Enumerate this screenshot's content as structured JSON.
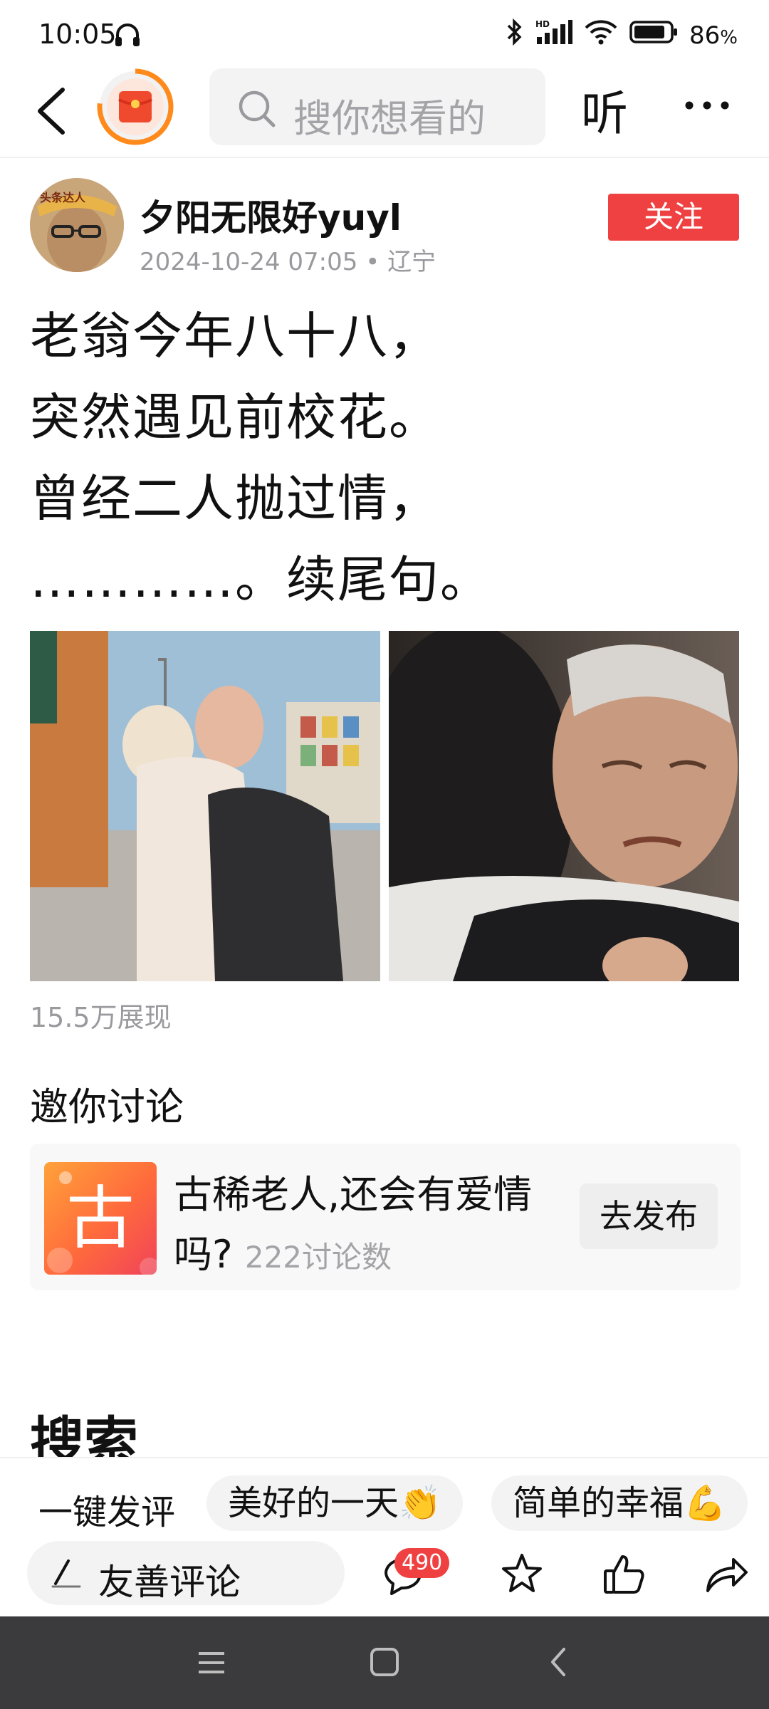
{
  "status_bar": {
    "time": "10:05",
    "battery": "86"
  },
  "header": {
    "search_placeholder": "搜你想看的",
    "listen_label": "听"
  },
  "author": {
    "name": "夕阳无限好yuyl",
    "date": "2024-10-24 07:05",
    "location": "辽宁",
    "follow_label": "关注",
    "avatar_badge": "头条达人"
  },
  "post": {
    "lines": [
      "老翁今年八十八，",
      "突然遇见前校花。",
      "曾经二人抛过情，",
      "…………。续尾句。"
    ],
    "views": "15.5万展现"
  },
  "discussion": {
    "section_title": "邀你讨论",
    "icon_char": "古",
    "topic": "古稀老人,还会有爱情吗?",
    "count": "222讨论数",
    "publish_label": "去发布"
  },
  "search_heading": "搜索",
  "comment_bar": {
    "quick_label": "一键发评",
    "chips": [
      "美好的一天👏",
      "简单的幸福💪"
    ],
    "input_placeholder": "友善评论",
    "comment_count": "490"
  },
  "colors": {
    "accent_red": "#f04142",
    "muted_text": "#9a9a9e"
  }
}
